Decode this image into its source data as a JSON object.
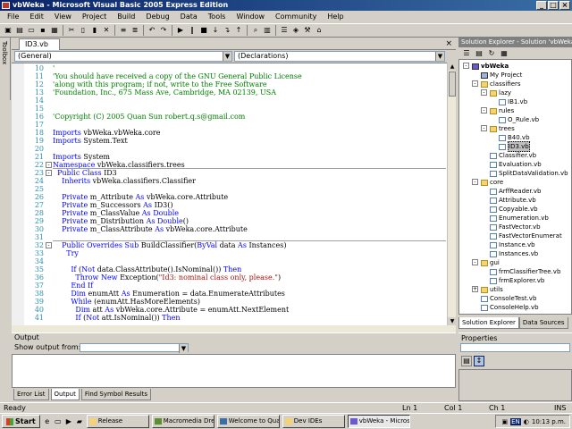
{
  "window": {
    "title": "vbWeka - Microsoft Visual Basic 2005 Express Edition",
    "buttons": [
      "_",
      "□",
      "×"
    ]
  },
  "menu": [
    "File",
    "Edit",
    "View",
    "Project",
    "Build",
    "Debug",
    "Data",
    "Tools",
    "Window",
    "Community",
    "Help"
  ],
  "toolbar": {
    "icons": [
      {
        "name": "new-project-icon",
        "glyph": "▣"
      },
      {
        "name": "add-item-icon",
        "glyph": "▤"
      },
      {
        "name": "open-icon",
        "glyph": "▭"
      },
      {
        "name": "save-icon",
        "glyph": "▪"
      },
      {
        "name": "save-all-icon",
        "glyph": "▦"
      },
      {
        "name": "cut-icon",
        "glyph": "✂"
      },
      {
        "name": "copy-icon",
        "glyph": "▯"
      },
      {
        "name": "paste-icon",
        "glyph": "▮"
      },
      {
        "name": "delete-icon",
        "glyph": "✕"
      },
      {
        "name": "comment-icon",
        "glyph": "≡"
      },
      {
        "name": "uncomment-icon",
        "glyph": "≣"
      },
      {
        "name": "undo-icon",
        "glyph": "↶"
      },
      {
        "name": "redo-icon",
        "glyph": "↷"
      },
      {
        "name": "start-debug-icon",
        "glyph": "▶"
      },
      {
        "name": "pause-icon",
        "glyph": "‖"
      },
      {
        "name": "stop-icon",
        "glyph": "■"
      },
      {
        "name": "step-into-icon",
        "glyph": "↓"
      },
      {
        "name": "step-over-icon",
        "glyph": "↴"
      },
      {
        "name": "step-out-icon",
        "glyph": "↑"
      },
      {
        "name": "find-icon",
        "glyph": "⌕"
      },
      {
        "name": "solution-explorer-icon",
        "glyph": "▥"
      },
      {
        "name": "properties-icon",
        "glyph": "☰"
      },
      {
        "name": "object-browser-icon",
        "glyph": "◈"
      },
      {
        "name": "toolbox-icon",
        "glyph": "⚒"
      },
      {
        "name": "start-page-icon",
        "glyph": "⌂"
      }
    ]
  },
  "toolbox_label": "Toolbox",
  "document": {
    "tab": "ID3.vb",
    "combo_left": "(General)",
    "combo_right": "(Declarations)",
    "lines": [
      {
        "ln": "10",
        "parts": [
          {
            "t": "'",
            "c": "c"
          }
        ]
      },
      {
        "ln": "11",
        "parts": [
          {
            "t": "'You should have received a copy of the GNU General Public License",
            "c": "c"
          }
        ]
      },
      {
        "ln": "12",
        "parts": [
          {
            "t": "'along with this program; if not, write to the Free Software",
            "c": "c"
          }
        ]
      },
      {
        "ln": "13",
        "parts": [
          {
            "t": "'Foundation, Inc., 675 Mass Ave, Cambridge, MA 02139, USA",
            "c": "c"
          }
        ]
      },
      {
        "ln": "14",
        "parts": []
      },
      {
        "ln": "15",
        "parts": []
      },
      {
        "ln": "16",
        "parts": [
          {
            "t": "'Copyright (C) 2005 Quan Sun robert.q.s@gmail.com",
            "c": "c"
          }
        ]
      },
      {
        "ln": "17",
        "parts": []
      },
      {
        "ln": "18",
        "parts": [
          {
            "t": "Imports",
            "c": "k"
          },
          {
            "t": " vbWeka.vbWeka.core",
            "c": ""
          }
        ]
      },
      {
        "ln": "19",
        "parts": [
          {
            "t": "Imports",
            "c": "k"
          },
          {
            "t": " System.Text",
            "c": ""
          }
        ]
      },
      {
        "ln": "20",
        "parts": []
      },
      {
        "ln": "21",
        "parts": [
          {
            "t": "Imports",
            "c": "k"
          },
          {
            "t": " System",
            "c": ""
          }
        ]
      },
      {
        "ln": "22",
        "parts": [
          {
            "t": "Namespace",
            "c": "k"
          },
          {
            "t": " vbWeka.classifiers.trees",
            "c": ""
          }
        ]
      },
      {
        "ln": "23",
        "parts": [
          {
            "t": "  Public Class",
            "c": "k"
          },
          {
            "t": " ID3",
            "c": ""
          }
        ]
      },
      {
        "ln": "24",
        "parts": [
          {
            "t": "    Inherits",
            "c": "k"
          },
          {
            "t": " vbWeka.classifiers.Classifier",
            "c": ""
          }
        ]
      },
      {
        "ln": "25",
        "parts": []
      },
      {
        "ln": "26",
        "parts": [
          {
            "t": "    Private",
            "c": "k"
          },
          {
            "t": " m_Attribute ",
            "c": ""
          },
          {
            "t": "As",
            "c": "k"
          },
          {
            "t": " vbWeka.core.Attribute",
            "c": ""
          }
        ]
      },
      {
        "ln": "27",
        "parts": [
          {
            "t": "    Private",
            "c": "k"
          },
          {
            "t": " m_Successors ",
            "c": ""
          },
          {
            "t": "As",
            "c": "k"
          },
          {
            "t": " ID3()",
            "c": ""
          }
        ]
      },
      {
        "ln": "28",
        "parts": [
          {
            "t": "    Private",
            "c": "k"
          },
          {
            "t": " m_ClassValue ",
            "c": ""
          },
          {
            "t": "As Double",
            "c": "k"
          }
        ]
      },
      {
        "ln": "29",
        "parts": [
          {
            "t": "    Private",
            "c": "k"
          },
          {
            "t": " m_Distribution ",
            "c": ""
          },
          {
            "t": "As Double",
            "c": "k"
          },
          {
            "t": "()",
            "c": ""
          }
        ]
      },
      {
        "ln": "30",
        "parts": [
          {
            "t": "    Private",
            "c": "k"
          },
          {
            "t": " m_ClassAttribute ",
            "c": ""
          },
          {
            "t": "As",
            "c": "k"
          },
          {
            "t": " vbWeka.core.Attribute",
            "c": ""
          }
        ]
      },
      {
        "ln": "31",
        "parts": []
      },
      {
        "ln": "32",
        "parts": [
          {
            "t": "    Public Overrides Sub",
            "c": "k"
          },
          {
            "t": " BuildClassifier(",
            "c": ""
          },
          {
            "t": "ByVal",
            "c": "k"
          },
          {
            "t": " data ",
            "c": ""
          },
          {
            "t": "As",
            "c": "k"
          },
          {
            "t": " Instances)",
            "c": ""
          }
        ]
      },
      {
        "ln": "33",
        "parts": [
          {
            "t": "      Try",
            "c": "k"
          }
        ]
      },
      {
        "ln": "34",
        "parts": []
      },
      {
        "ln": "35",
        "parts": [
          {
            "t": "        If",
            "c": "k"
          },
          {
            "t": " (",
            "c": ""
          },
          {
            "t": "Not",
            "c": "k"
          },
          {
            "t": " data.ClassAttribute().IsNominal()) ",
            "c": ""
          },
          {
            "t": "Then",
            "c": "k"
          }
        ]
      },
      {
        "ln": "36",
        "parts": [
          {
            "t": "          Throw New",
            "c": "k"
          },
          {
            "t": " Exception(",
            "c": ""
          },
          {
            "t": "\"Id3: nominal class only, please.\"",
            "c": "s"
          },
          {
            "t": ")",
            "c": ""
          }
        ]
      },
      {
        "ln": "37",
        "parts": [
          {
            "t": "        End If",
            "c": "k"
          }
        ]
      },
      {
        "ln": "38",
        "parts": [
          {
            "t": "        Dim",
            "c": "k"
          },
          {
            "t": " enumAtt ",
            "c": ""
          },
          {
            "t": "As",
            "c": "k"
          },
          {
            "t": " Enumeration = data.EnumerateAttributes",
            "c": ""
          }
        ]
      },
      {
        "ln": "39",
        "parts": [
          {
            "t": "        While",
            "c": "k"
          },
          {
            "t": " (enumAtt.HasMoreElements)",
            "c": ""
          }
        ]
      },
      {
        "ln": "40",
        "parts": [
          {
            "t": "          Dim",
            "c": "k"
          },
          {
            "t": " att ",
            "c": ""
          },
          {
            "t": "As",
            "c": "k"
          },
          {
            "t": " vbWeka.core.Attribute = enumAtt.NextElement",
            "c": ""
          }
        ]
      },
      {
        "ln": "41",
        "parts": [
          {
            "t": "          If",
            "c": "k"
          },
          {
            "t": " (",
            "c": ""
          },
          {
            "t": "Not",
            "c": "k"
          },
          {
            "t": " att.IsNominal()) ",
            "c": ""
          },
          {
            "t": "Then",
            "c": "k"
          }
        ]
      }
    ]
  },
  "output": {
    "title": "Output",
    "show_from_label": "Show output from:",
    "value": ""
  },
  "bottom_tabs": [
    "Error List",
    "Output",
    "Find Symbol Results"
  ],
  "status": {
    "text": "Ready",
    "ln": "Ln 1",
    "col": "Col 1",
    "ch": "Ch 1",
    "mode": "INS"
  },
  "solution_explorer": {
    "title": "Solution Explorer - Solution 'vbWeka'",
    "tree": [
      {
        "label": "vbWeka",
        "icon": "proj",
        "depth": 0,
        "bold": true,
        "pm": "-"
      },
      {
        "label": "My Project",
        "icon": "ref",
        "depth": 1
      },
      {
        "label": "classifiers",
        "icon": "folder",
        "depth": 1,
        "pm": "-"
      },
      {
        "label": "lazy",
        "icon": "folder",
        "depth": 2,
        "pm": "-"
      },
      {
        "label": "IB1.vb",
        "icon": "file",
        "depth": 3
      },
      {
        "label": "rules",
        "icon": "folder",
        "depth": 2,
        "pm": "-"
      },
      {
        "label": "O_Rule.vb",
        "icon": "file",
        "depth": 3
      },
      {
        "label": "trees",
        "icon": "folder",
        "depth": 2,
        "pm": "-"
      },
      {
        "label": "B40.vb",
        "icon": "file",
        "depth": 3
      },
      {
        "label": "ID3.vb",
        "icon": "file",
        "depth": 3,
        "selected": true
      },
      {
        "label": "Classifier.vb",
        "icon": "file",
        "depth": 2
      },
      {
        "label": "Evaluation.vb",
        "icon": "file",
        "depth": 2
      },
      {
        "label": "SplitDataValidation.vb",
        "icon": "file",
        "depth": 2
      },
      {
        "label": "core",
        "icon": "folder",
        "depth": 1,
        "pm": "-"
      },
      {
        "label": "ArffReader.vb",
        "icon": "file",
        "depth": 2
      },
      {
        "label": "Attribute.vb",
        "icon": "file",
        "depth": 2
      },
      {
        "label": "Copyable.vb",
        "icon": "file",
        "depth": 2
      },
      {
        "label": "Enumeration.vb",
        "icon": "file",
        "depth": 2
      },
      {
        "label": "FastVector.vb",
        "icon": "file",
        "depth": 2
      },
      {
        "label": "FastVectorEnumerat",
        "icon": "file",
        "depth": 2
      },
      {
        "label": "Instance.vb",
        "icon": "file",
        "depth": 2
      },
      {
        "label": "Instances.vb",
        "icon": "file",
        "depth": 2
      },
      {
        "label": "gui",
        "icon": "folder",
        "depth": 1,
        "pm": "-"
      },
      {
        "label": "frmClassifierTree.vb",
        "icon": "file",
        "depth": 2
      },
      {
        "label": "frmExplorer.vb",
        "icon": "file",
        "depth": 2
      },
      {
        "label": "utils",
        "icon": "folder",
        "depth": 1,
        "pm": "+"
      },
      {
        "label": "ConsoleTest.vb",
        "icon": "file",
        "depth": 1
      },
      {
        "label": "ConsoleHelp.vb",
        "icon": "file",
        "depth": 1
      }
    ],
    "tabs": [
      "Solution Explorer",
      "Data Sources"
    ]
  },
  "properties": {
    "title": "Properties"
  },
  "taskbar": {
    "start": "Start",
    "quick_launch": [
      "ie-icon",
      "desktop-icon",
      "media-icon",
      "folder-icon"
    ],
    "buttons": [
      {
        "label": "Release",
        "active": false,
        "color": "#f5d273"
      },
      {
        "label": "Macromedia Dream...",
        "active": false,
        "color": "#5d8f2e"
      },
      {
        "label": "Welcome to Quan S...",
        "active": false,
        "color": "#3a6ea5"
      },
      {
        "label": "Dev IDEs",
        "active": false,
        "color": "#f5d273"
      },
      {
        "label": "vbWeka - Microso...",
        "active": true,
        "color": "#6a5acd"
      }
    ],
    "tray_lang": "EN",
    "clock": "10:13 p.m."
  },
  "colors": {
    "keyword": "#0000ff",
    "comment": "#008000",
    "string": "#a31515",
    "titlebar": "#0a246a"
  }
}
